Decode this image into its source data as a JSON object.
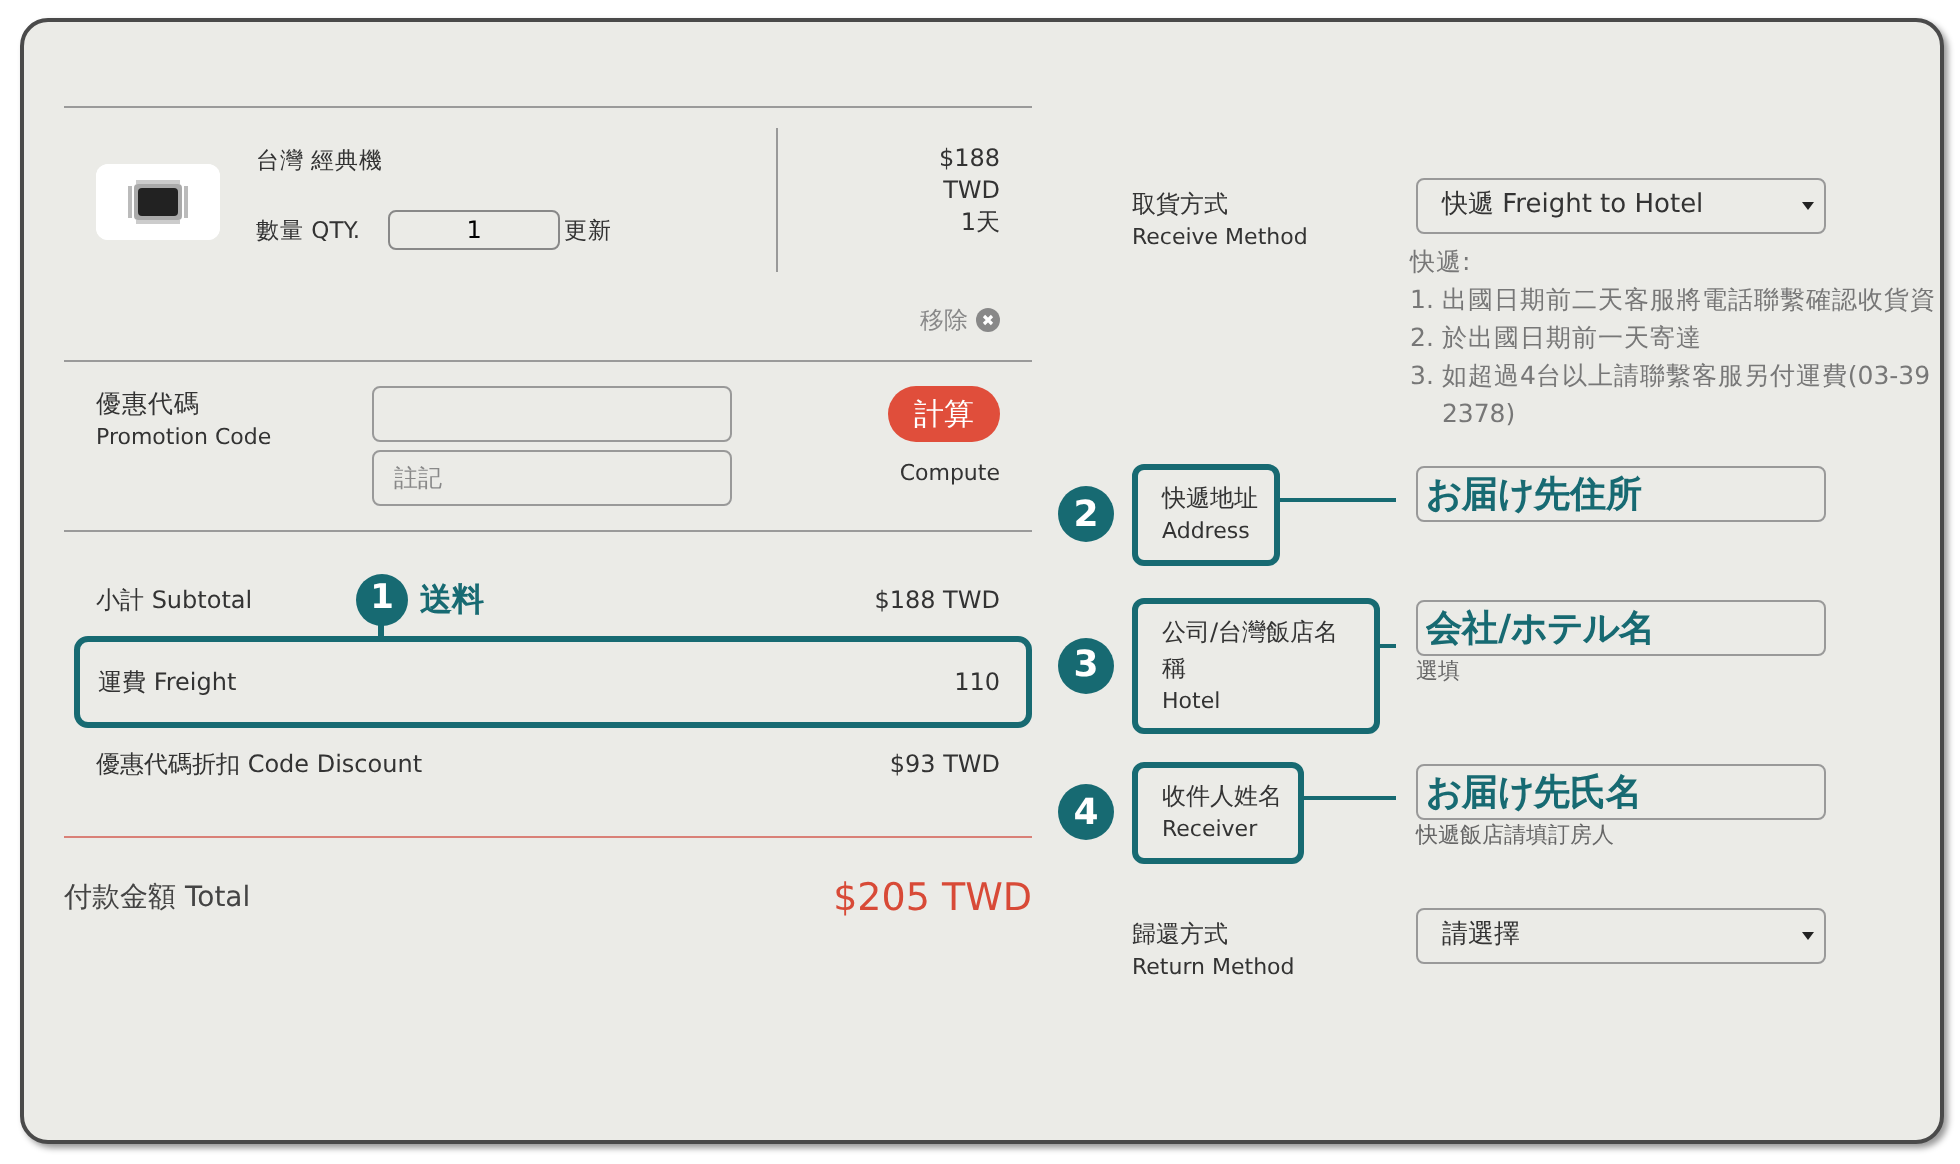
{
  "cart_item": {
    "name": "台灣 經典機",
    "qty_label": "數量 QTY.",
    "qty": "1",
    "update": "更新",
    "price_lines": [
      "$188",
      "TWD",
      "1天"
    ],
    "remove": "移除"
  },
  "promotion": {
    "label": "優惠代碼",
    "label_en": "Promotion Code",
    "note_placeholder": "註記",
    "button": "計算",
    "button_caption": "Compute"
  },
  "summary": [
    {
      "label": "小計 Subtotal",
      "value": "$188 TWD",
      "highlighted": false
    },
    {
      "label": "運費 Freight",
      "value": "110",
      "highlighted": true,
      "callout": {
        "number": "1",
        "text": "送料"
      }
    },
    {
      "label": "優惠代碼折扣 Code Discount",
      "value": "$93 TWD",
      "highlighted": false
    }
  ],
  "total": {
    "label": "付款金額 Total",
    "value": "$205 TWD"
  },
  "receive_method": {
    "label": "取貨方式",
    "label_en": "Receive Method",
    "value": "快遞 Freight to Hotel",
    "note_title": "快遞:",
    "notes": [
      {
        "number": "1.",
        "text": "出國日期前二天客服將電話聯繫確認收貨資"
      },
      {
        "number": "2.",
        "text": "於出國日期前一天寄達"
      },
      {
        "number": "3.",
        "text": "如超過4台以上請聯繫客服另付運費(03-39",
        "continuation": "2378)"
      }
    ]
  },
  "fields": [
    {
      "number": "2",
      "label": "快遞地址",
      "label_en": "Address",
      "value": "お届け先住所"
    },
    {
      "number": "3",
      "label": "公司/台灣飯店名稱",
      "label_en": "Hotel",
      "value": "会社/ホテル名",
      "hint": "選填"
    },
    {
      "number": "4",
      "label": "收件人姓名",
      "label_en": "Receiver",
      "value": "お届け先氏名",
      "hint": "快遞飯店請填訂房人"
    }
  ],
  "return_method": {
    "label": "歸還方式",
    "label_en": "Return Method",
    "value": "請選擇"
  }
}
